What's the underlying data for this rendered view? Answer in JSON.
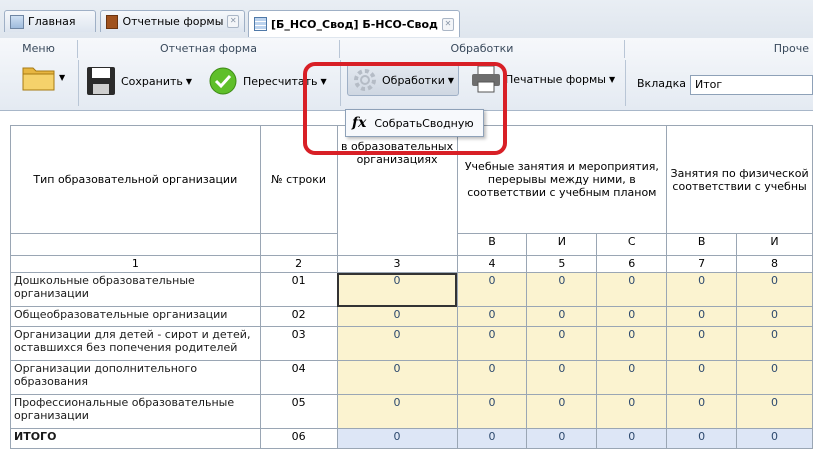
{
  "tabs": [
    {
      "label": "Главная",
      "closable": false
    },
    {
      "label": "Отчетные формы",
      "closable": true
    },
    {
      "label": "[Б_НСО_Свод] Б-НСО-Свод",
      "closable": true
    }
  ],
  "ribbon": {
    "groups": {
      "menu": "Меню",
      "report_form": "Отчетная форма",
      "processing": "Обработки",
      "other": "Проче"
    },
    "save": "Сохранить",
    "recalc": "Пересчитать",
    "processing_btn": "Обработки",
    "print_forms": "Печатные формы",
    "tab_label": "Вкладка",
    "tab_value": "Итог"
  },
  "dropdown": {
    "item_icon": "fx",
    "item_label": "СобратьСводную"
  },
  "table": {
    "col_type": "Тип образовательной организации",
    "col_row": "№ строки",
    "col3_top": "В",
    "col3_rest": "в образовательных организациях",
    "col_group1": "Учебные занятия и мероприятия, перерывы между ними, в соответствии с учебным планом",
    "col_group2": "Занятия по физической соответствии с учебны",
    "sub_headers": [
      "В",
      "И",
      "С",
      "В",
      "И"
    ],
    "col_numbers": [
      "1",
      "2",
      "3",
      "4",
      "5",
      "6",
      "7",
      "8"
    ],
    "rows": [
      {
        "name": "Дошкольные образовательные организации",
        "code": "01",
        "values": [
          "0",
          "0",
          "0",
          "0",
          "0",
          "0"
        ]
      },
      {
        "name": "Общеобразовательные организации",
        "code": "02",
        "values": [
          "0",
          "0",
          "0",
          "0",
          "0",
          "0"
        ]
      },
      {
        "name": "Организации для детей - сирот и детей, оставшихся без попечения родителей",
        "code": "03",
        "values": [
          "0",
          "0",
          "0",
          "0",
          "0",
          "0"
        ]
      },
      {
        "name": "Организации дополнительного образования",
        "code": "04",
        "values": [
          "0",
          "0",
          "0",
          "0",
          "0",
          "0"
        ]
      },
      {
        "name": "Профессиональные образовательные организации",
        "code": "05",
        "values": [
          "0",
          "0",
          "0",
          "0",
          "0",
          "0"
        ]
      }
    ],
    "total": {
      "name": "ИТОГО",
      "code": "06",
      "values": [
        "0",
        "0",
        "0",
        "0",
        "0",
        "0"
      ]
    }
  },
  "colors": {
    "highlight": "#d81f26",
    "cell_fill": "#fbf3d0",
    "total_fill": "#dde6f6"
  }
}
